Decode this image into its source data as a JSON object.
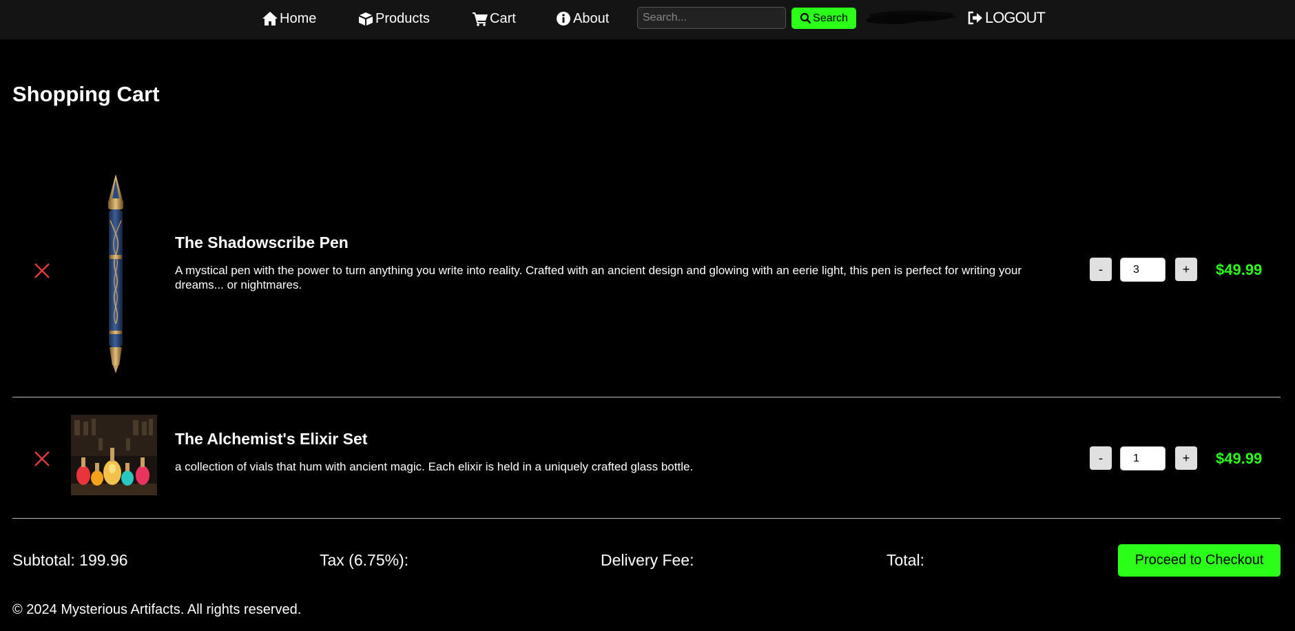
{
  "nav": {
    "home": "Home",
    "products": "Products",
    "cart": "Cart",
    "about": "About",
    "search_placeholder": "Search...",
    "search_button": "Search",
    "logout": "LOGOUT",
    "icons": [
      "home-icon",
      "box-icon",
      "cart-icon",
      "info-icon",
      "search-icon",
      "logout-icon"
    ]
  },
  "page": {
    "title": "Shopping Cart"
  },
  "cart": {
    "items": [
      {
        "name": "The Shadowscribe Pen",
        "description": "A mystical pen with the power to turn anything you write into reality. Crafted with an ancient design and glowing with an eerie light, this pen is perfect for writing your dreams... or nightmares.",
        "quantity": "3",
        "price": "$49.99",
        "decrement": "-",
        "increment": "+"
      },
      {
        "name": "The Alchemist's Elixir Set",
        "description": "a collection of vials that hum with ancient magic. Each elixir is held in a uniquely crafted glass bottle.",
        "quantity": "1",
        "price": "$49.99",
        "decrement": "-",
        "increment": "+"
      }
    ]
  },
  "totals": {
    "subtotal": "Subtotal: 199.96",
    "tax": "Tax (6.75%):",
    "delivery": "Delivery Fee:",
    "total": "Total:",
    "checkout_button": "Proceed to Checkout"
  },
  "footer": {
    "text": "© 2024 Mysterious Artifacts. All rights reserved."
  },
  "colors": {
    "accent": "#2bff19",
    "remove": "#e23b3b",
    "background": "#000000",
    "nav_background": "#141414"
  }
}
